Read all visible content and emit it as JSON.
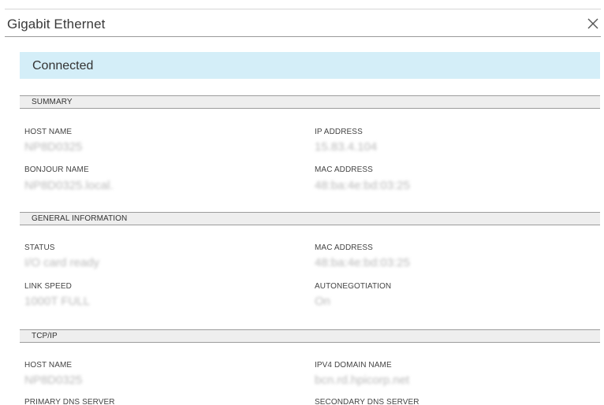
{
  "dialog": {
    "title": "Gigabit Ethernet",
    "close_icon": "close-icon"
  },
  "status": {
    "text": "Connected",
    "color": "#d4eef8"
  },
  "sections": {
    "summary": {
      "title": "SUMMARY",
      "host_name_label": "HOST NAME",
      "host_name_value": "NP8D0325",
      "ip_address_label": "IP ADDRESS",
      "ip_address_value": "15.83.4.104",
      "bonjour_name_label": "BONJOUR NAME",
      "bonjour_name_value": "NP8D0325.local.",
      "mac_address_label": "MAC ADDRESS",
      "mac_address_value": "48:ba:4e:bd:03:25"
    },
    "general": {
      "title": "GENERAL INFORMATION",
      "status_label": "STATUS",
      "status_value": "I/O card ready",
      "mac_address_label": "MAC ADDRESS",
      "mac_address_value": "48:ba:4e:bd:03:25",
      "link_speed_label": "LINK SPEED",
      "link_speed_value": "1000T FULL",
      "autonegotiation_label": "AUTONEGOTIATION",
      "autonegotiation_value": "On"
    },
    "tcpip": {
      "title": "TCP/IP",
      "host_name_label": "HOST NAME",
      "host_name_value": "NP8D0325",
      "ipv4_domain_label": "IPV4 DOMAIN NAME",
      "ipv4_domain_value": "bcn.rd.hpicorp.net",
      "primary_dns_label": "PRIMARY DNS SERVER",
      "secondary_dns_label": "SECONDARY DNS SERVER"
    }
  }
}
